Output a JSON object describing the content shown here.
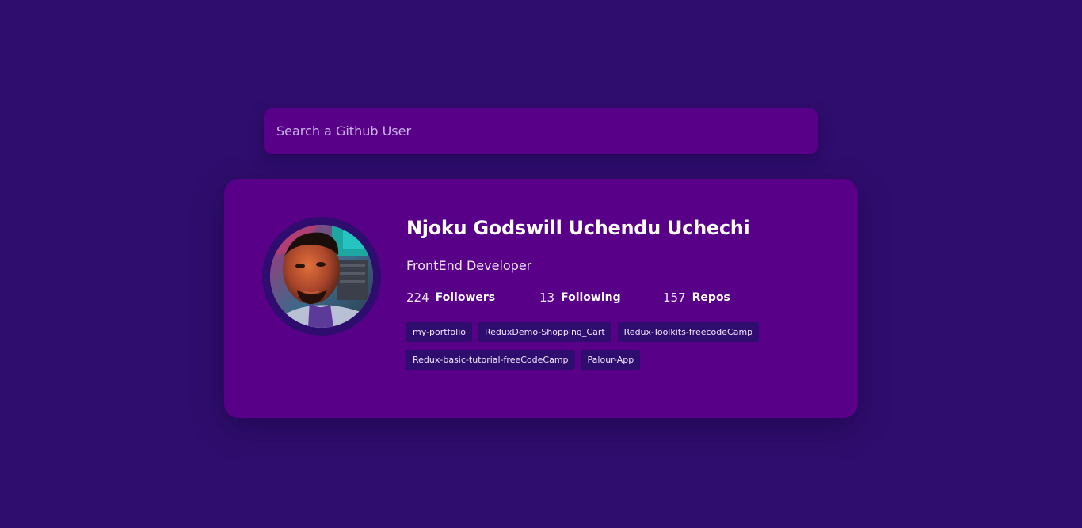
{
  "search": {
    "placeholder": "Search a Github User",
    "value": ""
  },
  "profile": {
    "name": "Njoku Godswill Uchendu Uchechi",
    "bio": "FrontEnd Developer",
    "avatar_icon": "user-photo",
    "stats": {
      "followers_count": "224",
      "followers_label": "Followers",
      "following_count": "13",
      "following_label": "Following",
      "repos_count": "157",
      "repos_label": "Repos"
    },
    "repos": [
      "my-portfolio",
      "ReduxDemo-Shopping_Cart",
      "Redux-Toolkits-freecodeCamp",
      "Redux-basic-tutorial-freeCodeCamp",
      "Palour-App"
    ]
  },
  "colors": {
    "background": "#2f0d6e",
    "card": "#590088",
    "tag": "#2f0d6e",
    "text": "#ffffff"
  }
}
